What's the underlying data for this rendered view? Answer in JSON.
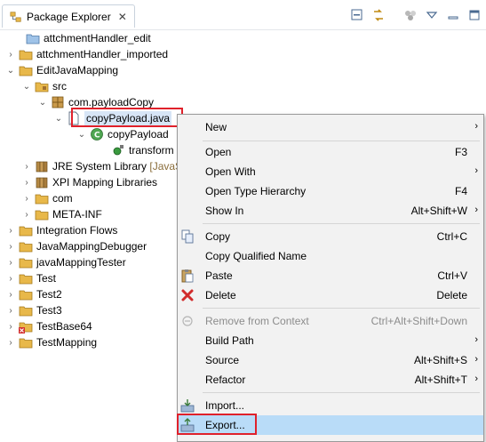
{
  "view": {
    "tab_title": "Package Explorer",
    "close_glyph": "✕",
    "toolbar_icons": [
      "collapse-all-icon",
      "link-with-editor-icon",
      "focus-icon",
      "view-menu-icon",
      "minimize-icon",
      "maximize-icon"
    ]
  },
  "tree": {
    "items": [
      {
        "label": "attchmentHandler_edit"
      },
      {
        "label": "attchmentHandler_imported"
      },
      {
        "label": "EditJavaMapping"
      },
      {
        "label": "src"
      },
      {
        "label": "com.payloadCopy"
      },
      {
        "label": "copyPayload.java"
      },
      {
        "label": "copyPayload"
      },
      {
        "label": "transform"
      },
      {
        "label": "JRE System Library",
        "decoration": "[JavaS"
      },
      {
        "label": "XPI Mapping Libraries"
      },
      {
        "label": "com"
      },
      {
        "label": "META-INF"
      },
      {
        "label": "Integration Flows"
      },
      {
        "label": "JavaMappingDebugger"
      },
      {
        "label": "javaMappingTester"
      },
      {
        "label": "Test"
      },
      {
        "label": "Test2"
      },
      {
        "label": "Test3"
      },
      {
        "label": "TestBase64"
      },
      {
        "label": "TestMapping"
      }
    ]
  },
  "menu": {
    "items": [
      {
        "label": "New",
        "accel": "",
        "submenu": true
      },
      {
        "label": "Open",
        "accel": "F3"
      },
      {
        "label": "Open With",
        "accel": "",
        "submenu": true
      },
      {
        "label": "Open Type Hierarchy",
        "accel": "F4"
      },
      {
        "label": "Show In",
        "accel": "Alt+Shift+W",
        "submenu": true
      },
      {
        "label": "Copy",
        "accel": "Ctrl+C"
      },
      {
        "label": "Copy Qualified Name",
        "accel": ""
      },
      {
        "label": "Paste",
        "accel": "Ctrl+V"
      },
      {
        "label": "Delete",
        "accel": "Delete"
      },
      {
        "label": "Remove from Context",
        "accel": "Ctrl+Alt+Shift+Down",
        "disabled": true
      },
      {
        "label": "Build Path",
        "accel": "",
        "submenu": true
      },
      {
        "label": "Source",
        "accel": "Alt+Shift+S",
        "submenu": true
      },
      {
        "label": "Refactor",
        "accel": "Alt+Shift+T",
        "submenu": true
      },
      {
        "label": "Import...",
        "accel": ""
      },
      {
        "label": "Export...",
        "accel": ""
      }
    ],
    "arrow_glyph": "›"
  },
  "colors": {
    "highlight": "#b9dcf8",
    "annotation_box": "#e0212b",
    "folder": "#e8b84a",
    "project": "#dcae45"
  }
}
